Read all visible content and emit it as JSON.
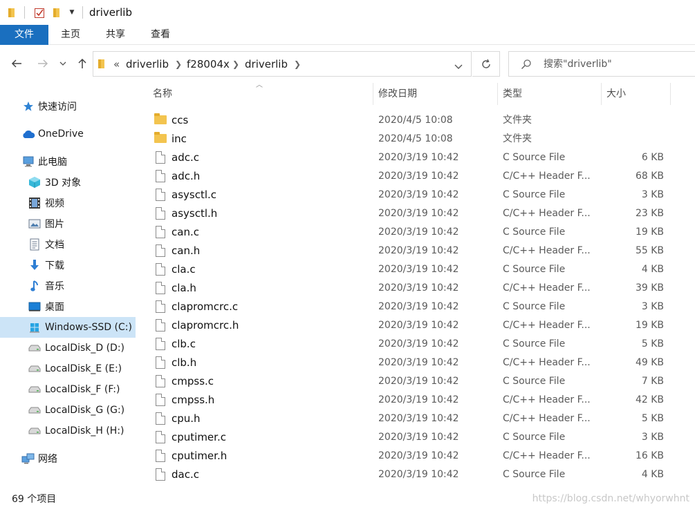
{
  "window": {
    "title": "driverlib"
  },
  "ribbon": {
    "tabs": [
      {
        "label": "文件"
      },
      {
        "label": "主页"
      },
      {
        "label": "共享"
      },
      {
        "label": "查看"
      }
    ]
  },
  "address": {
    "overflow": "«",
    "crumbs": [
      "driverlib",
      "f28004x",
      "driverlib"
    ]
  },
  "search": {
    "placeholder": "搜索\"driverlib\""
  },
  "columns": {
    "name": "名称",
    "date": "修改日期",
    "type": "类型",
    "size": "大小"
  },
  "nav": {
    "quick_access": "快速访问",
    "onedrive": "OneDrive",
    "this_pc": "此电脑",
    "objects3d": "3D 对象",
    "videos": "视频",
    "pictures": "图片",
    "documents": "文档",
    "downloads": "下载",
    "music": "音乐",
    "desktop": "桌面",
    "drive_c": "Windows-SSD (C:)",
    "drive_d": "LocalDisk_D (D:)",
    "drive_e": "LocalDisk_E (E:)",
    "drive_f": "LocalDisk_F (F:)",
    "drive_g": "LocalDisk_G (G:)",
    "drive_h": "LocalDisk_H (H:)",
    "network": "网络"
  },
  "files": [
    {
      "name": "ccs",
      "date": "2020/4/5 10:08",
      "type": "文件夹",
      "size": "",
      "kind": "folder"
    },
    {
      "name": "inc",
      "date": "2020/4/5 10:08",
      "type": "文件夹",
      "size": "",
      "kind": "folder"
    },
    {
      "name": "adc.c",
      "date": "2020/3/19 10:42",
      "type": "C Source File",
      "size": "6 KB",
      "kind": "file"
    },
    {
      "name": "adc.h",
      "date": "2020/3/19 10:42",
      "type": "C/C++ Header F...",
      "size": "68 KB",
      "kind": "file"
    },
    {
      "name": "asysctl.c",
      "date": "2020/3/19 10:42",
      "type": "C Source File",
      "size": "3 KB",
      "kind": "file"
    },
    {
      "name": "asysctl.h",
      "date": "2020/3/19 10:42",
      "type": "C/C++ Header F...",
      "size": "23 KB",
      "kind": "file"
    },
    {
      "name": "can.c",
      "date": "2020/3/19 10:42",
      "type": "C Source File",
      "size": "19 KB",
      "kind": "file"
    },
    {
      "name": "can.h",
      "date": "2020/3/19 10:42",
      "type": "C/C++ Header F...",
      "size": "55 KB",
      "kind": "file"
    },
    {
      "name": "cla.c",
      "date": "2020/3/19 10:42",
      "type": "C Source File",
      "size": "4 KB",
      "kind": "file"
    },
    {
      "name": "cla.h",
      "date": "2020/3/19 10:42",
      "type": "C/C++ Header F...",
      "size": "39 KB",
      "kind": "file"
    },
    {
      "name": "clapromcrc.c",
      "date": "2020/3/19 10:42",
      "type": "C Source File",
      "size": "3 KB",
      "kind": "file"
    },
    {
      "name": "clapromcrc.h",
      "date": "2020/3/19 10:42",
      "type": "C/C++ Header F...",
      "size": "19 KB",
      "kind": "file"
    },
    {
      "name": "clb.c",
      "date": "2020/3/19 10:42",
      "type": "C Source File",
      "size": "5 KB",
      "kind": "file"
    },
    {
      "name": "clb.h",
      "date": "2020/3/19 10:42",
      "type": "C/C++ Header F...",
      "size": "49 KB",
      "kind": "file"
    },
    {
      "name": "cmpss.c",
      "date": "2020/3/19 10:42",
      "type": "C Source File",
      "size": "7 KB",
      "kind": "file"
    },
    {
      "name": "cmpss.h",
      "date": "2020/3/19 10:42",
      "type": "C/C++ Header F...",
      "size": "42 KB",
      "kind": "file"
    },
    {
      "name": "cpu.h",
      "date": "2020/3/19 10:42",
      "type": "C/C++ Header F...",
      "size": "5 KB",
      "kind": "file"
    },
    {
      "name": "cputimer.c",
      "date": "2020/3/19 10:42",
      "type": "C Source File",
      "size": "3 KB",
      "kind": "file"
    },
    {
      "name": "cputimer.h",
      "date": "2020/3/19 10:42",
      "type": "C/C++ Header F...",
      "size": "16 KB",
      "kind": "file"
    },
    {
      "name": "dac.c",
      "date": "2020/3/19 10:42",
      "type": "C Source File",
      "size": "4 KB",
      "kind": "file"
    }
  ],
  "status": {
    "item_count": "69 个项目"
  },
  "watermark": "https://blog.csdn.net/whyorwhnt",
  "colors": {
    "accent": "#1a6fbf",
    "selected": "#cce4f7",
    "folder": "#f3c44f"
  }
}
